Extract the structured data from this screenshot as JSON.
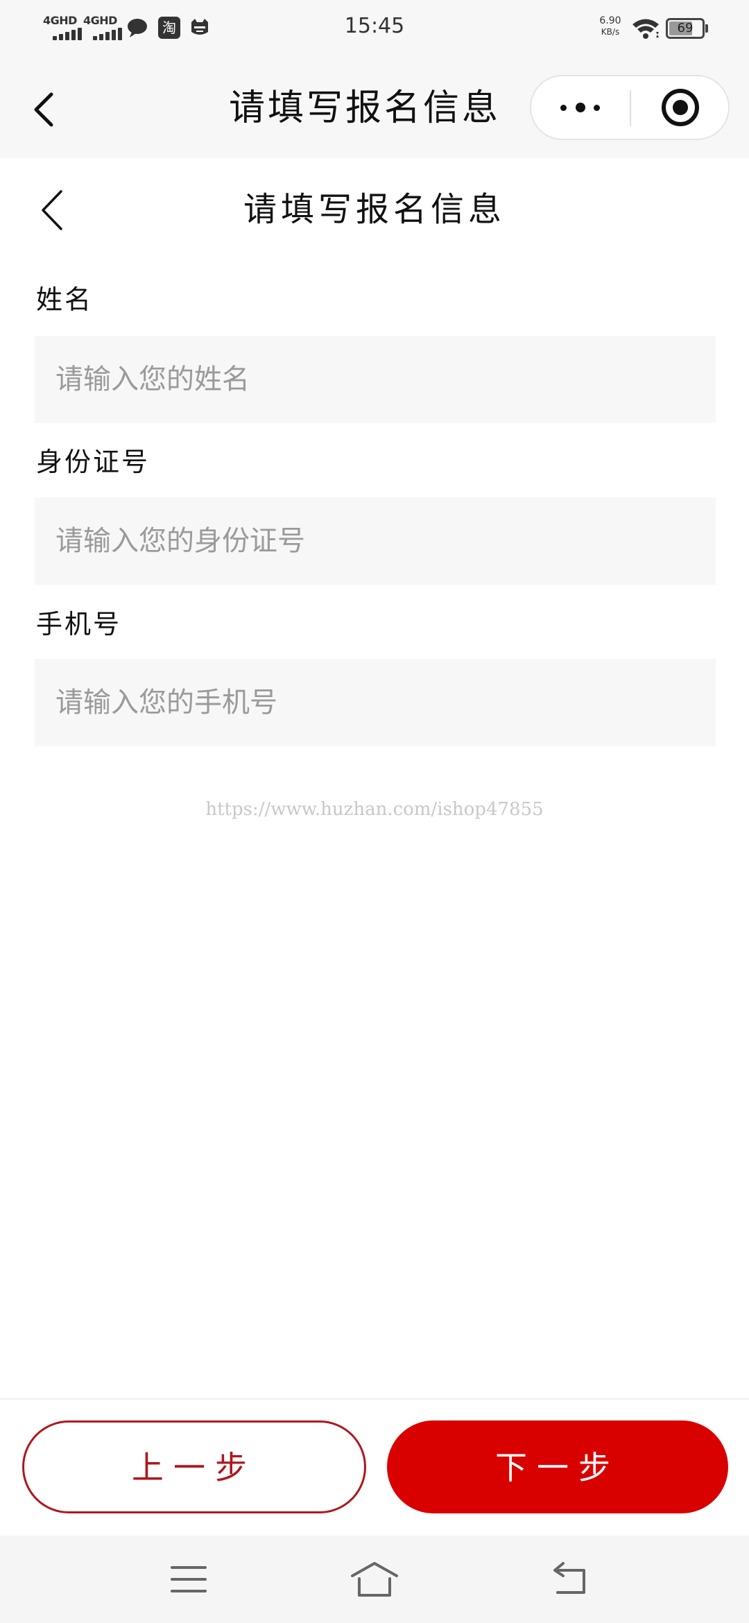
{
  "status_bar": {
    "network_1": "4GHD",
    "network_2": "4GHD",
    "app_icon_label": "淘",
    "time": "15:45",
    "speed_value": "6.90",
    "speed_unit": "KB/s",
    "battery": "69"
  },
  "mp_nav": {
    "title": "请填写报名信息"
  },
  "page": {
    "title": "请填写报名信息"
  },
  "form": {
    "fields": [
      {
        "label": "姓名",
        "placeholder": "请输入您的姓名",
        "value": ""
      },
      {
        "label": "身份证号",
        "placeholder": "请输入您的身份证号",
        "value": ""
      },
      {
        "label": "手机号",
        "placeholder": "请输入您的手机号",
        "value": ""
      }
    ]
  },
  "watermark": "https://www.huzhan.com/ishop47855",
  "actions": {
    "prev_label": "上一步",
    "next_label": "下一步"
  },
  "colors": {
    "accent": "#d90000",
    "accent_outline": "#b0161c",
    "field_bg": "#f7f7f7",
    "bar_bg": "#f7f7f7"
  },
  "icons": {
    "status": [
      "signal-icon",
      "message-bubble-icon",
      "taobao-icon",
      "cat-icon",
      "wifi-icon",
      "battery-icon"
    ],
    "nav": [
      "back-chevron-icon",
      "more-dots-icon",
      "close-target-icon"
    ],
    "system": [
      "menu-icon",
      "home-icon",
      "return-icon"
    ]
  }
}
